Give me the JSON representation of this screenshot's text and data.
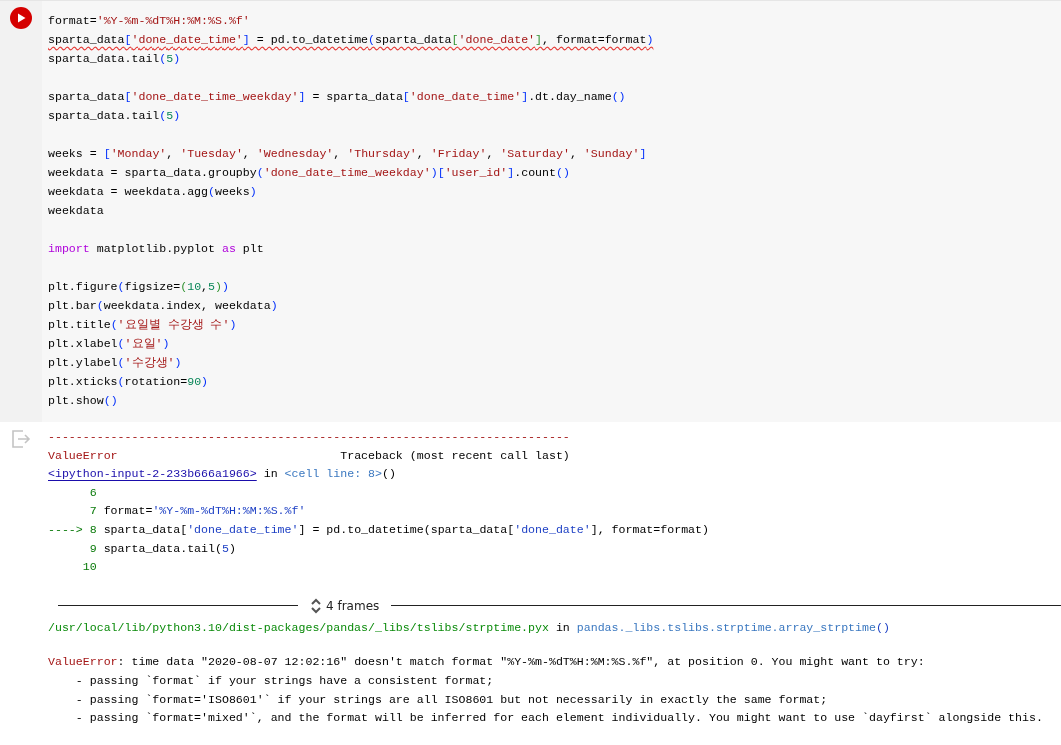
{
  "code_cell": {
    "run_button": {
      "kind": "play"
    },
    "blocks": [
      [
        {
          "lint_warning": false,
          "tokens": [
            {
              "text": "format=",
              "kind": "plain"
            },
            {
              "text": "'%Y-%m-%dT%H:%M:%S.%f'",
              "kind": "string"
            }
          ]
        },
        {
          "lint_warning": true,
          "tokens": [
            {
              "text": "sparta_data",
              "kind": "plain"
            },
            {
              "text": "[",
              "kind": "bracket"
            },
            {
              "text": "'done_date_time'",
              "kind": "string"
            },
            {
              "text": "]",
              "kind": "bracket"
            },
            {
              "text": " = pd.to_datetime",
              "kind": "plain"
            },
            {
              "text": "(",
              "kind": "bracket"
            },
            {
              "text": "sparta_data",
              "kind": "plain"
            },
            {
              "text": "[",
              "kind": "bracket2"
            },
            {
              "text": "'done_date'",
              "kind": "string"
            },
            {
              "text": "]",
              "kind": "bracket2"
            },
            {
              "text": ", format=format",
              "kind": "plain"
            },
            {
              "text": ")",
              "kind": "bracket"
            }
          ]
        },
        {
          "lint_warning": false,
          "tokens": [
            {
              "text": "sparta_data.tail",
              "kind": "plain"
            },
            {
              "text": "(",
              "kind": "bracket"
            },
            {
              "text": "5",
              "kind": "number"
            },
            {
              "text": ")",
              "kind": "bracket"
            }
          ]
        }
      ],
      [
        {
          "lint_warning": false,
          "tokens": [
            {
              "text": "sparta_data",
              "kind": "plain"
            },
            {
              "text": "[",
              "kind": "bracket"
            },
            {
              "text": "'done_date_time_weekday'",
              "kind": "string"
            },
            {
              "text": "]",
              "kind": "bracket"
            },
            {
              "text": " = sparta_data",
              "kind": "plain"
            },
            {
              "text": "[",
              "kind": "bracket"
            },
            {
              "text": "'done_date_time'",
              "kind": "string"
            },
            {
              "text": "]",
              "kind": "bracket"
            },
            {
              "text": ".dt.day_name",
              "kind": "plain"
            },
            {
              "text": "()",
              "kind": "bracket"
            }
          ]
        },
        {
          "lint_warning": false,
          "tokens": [
            {
              "text": "sparta_data.tail",
              "kind": "plain"
            },
            {
              "text": "(",
              "kind": "bracket"
            },
            {
              "text": "5",
              "kind": "number"
            },
            {
              "text": ")",
              "kind": "bracket"
            }
          ]
        }
      ],
      [
        {
          "lint_warning": false,
          "tokens": [
            {
              "text": "weeks = ",
              "kind": "plain"
            },
            {
              "text": "[",
              "kind": "bracket"
            },
            {
              "text": "'Monday'",
              "kind": "string"
            },
            {
              "text": ", ",
              "kind": "plain"
            },
            {
              "text": "'Tuesday'",
              "kind": "string"
            },
            {
              "text": ", ",
              "kind": "plain"
            },
            {
              "text": "'Wednesday'",
              "kind": "string"
            },
            {
              "text": ", ",
              "kind": "plain"
            },
            {
              "text": "'Thursday'",
              "kind": "string"
            },
            {
              "text": ", ",
              "kind": "plain"
            },
            {
              "text": "'Friday'",
              "kind": "string"
            },
            {
              "text": ", ",
              "kind": "plain"
            },
            {
              "text": "'Saturday'",
              "kind": "string"
            },
            {
              "text": ", ",
              "kind": "plain"
            },
            {
              "text": "'Sunday'",
              "kind": "string"
            },
            {
              "text": "]",
              "kind": "bracket"
            }
          ]
        },
        {
          "lint_warning": false,
          "tokens": [
            {
              "text": "weekdata = sparta_data.groupby",
              "kind": "plain"
            },
            {
              "text": "(",
              "kind": "bracket"
            },
            {
              "text": "'done_date_time_weekday'",
              "kind": "string"
            },
            {
              "text": ")",
              "kind": "bracket"
            },
            {
              "text": "[",
              "kind": "bracket"
            },
            {
              "text": "'user_id'",
              "kind": "string"
            },
            {
              "text": "]",
              "kind": "bracket"
            },
            {
              "text": ".count",
              "kind": "plain"
            },
            {
              "text": "()",
              "kind": "bracket"
            }
          ]
        },
        {
          "lint_warning": false,
          "tokens": [
            {
              "text": "weekdata = weekdata.agg",
              "kind": "plain"
            },
            {
              "text": "(",
              "kind": "bracket"
            },
            {
              "text": "weeks",
              "kind": "plain"
            },
            {
              "text": ")",
              "kind": "bracket"
            }
          ]
        },
        {
          "lint_warning": false,
          "tokens": [
            {
              "text": "weekdata",
              "kind": "plain"
            }
          ]
        }
      ],
      [
        {
          "lint_warning": false,
          "tokens": [
            {
              "text": "import",
              "kind": "keyword"
            },
            {
              "text": " matplotlib.pyplot ",
              "kind": "plain"
            },
            {
              "text": "as",
              "kind": "keyword"
            },
            {
              "text": " plt",
              "kind": "plain"
            }
          ]
        }
      ],
      [
        {
          "lint_warning": false,
          "tokens": [
            {
              "text": "plt.figure",
              "kind": "plain"
            },
            {
              "text": "(",
              "kind": "bracket"
            },
            {
              "text": "figsize=",
              "kind": "plain"
            },
            {
              "text": "(",
              "kind": "bracket2"
            },
            {
              "text": "10",
              "kind": "number"
            },
            {
              "text": ",",
              "kind": "plain"
            },
            {
              "text": "5",
              "kind": "number"
            },
            {
              "text": ")",
              "kind": "bracket2"
            },
            {
              "text": ")",
              "kind": "bracket"
            }
          ]
        },
        {
          "lint_warning": false,
          "tokens": [
            {
              "text": "plt.bar",
              "kind": "plain"
            },
            {
              "text": "(",
              "kind": "bracket"
            },
            {
              "text": "weekdata.index, weekdata",
              "kind": "plain"
            },
            {
              "text": ")",
              "kind": "bracket"
            }
          ]
        },
        {
          "lint_warning": false,
          "tokens": [
            {
              "text": "plt.title",
              "kind": "plain"
            },
            {
              "text": "(",
              "kind": "bracket"
            },
            {
              "text": "'요일별 수강생 수'",
              "kind": "string"
            },
            {
              "text": ")",
              "kind": "bracket"
            }
          ]
        },
        {
          "lint_warning": false,
          "tokens": [
            {
              "text": "plt.xlabel",
              "kind": "plain"
            },
            {
              "text": "(",
              "kind": "bracket"
            },
            {
              "text": "'요일'",
              "kind": "string"
            },
            {
              "text": ")",
              "kind": "bracket"
            }
          ]
        },
        {
          "lint_warning": false,
          "tokens": [
            {
              "text": "plt.ylabel",
              "kind": "plain"
            },
            {
              "text": "(",
              "kind": "bracket"
            },
            {
              "text": "'수강생'",
              "kind": "string"
            },
            {
              "text": ")",
              "kind": "bracket"
            }
          ]
        },
        {
          "lint_warning": false,
          "tokens": [
            {
              "text": "plt.xticks",
              "kind": "plain"
            },
            {
              "text": "(",
              "kind": "bracket"
            },
            {
              "text": "rotation=",
              "kind": "plain"
            },
            {
              "text": "90",
              "kind": "number"
            },
            {
              "text": ")",
              "kind": "bracket"
            }
          ]
        },
        {
          "lint_warning": false,
          "tokens": [
            {
              "text": "plt.show",
              "kind": "plain"
            },
            {
              "text": "()",
              "kind": "bracket"
            }
          ]
        }
      ]
    ]
  },
  "output": {
    "traceback": [
      {
        "tokens": [
          {
            "text": "---------------------------------------------------------------------------",
            "kind": "error"
          }
        ]
      },
      {
        "tokens": [
          {
            "text": "ValueError",
            "kind": "error"
          },
          {
            "text": "                                Traceback (most recent call last)",
            "kind": "plain"
          }
        ]
      },
      {
        "tokens": [
          {
            "text": "<ipython-input-2-233b666a1966>",
            "kind": "link"
          },
          {
            "text": " in ",
            "kind": "plain"
          },
          {
            "text": "<cell line: 8>",
            "kind": "ref"
          },
          {
            "text": "()",
            "kind": "plain"
          }
        ]
      },
      {
        "tokens": [
          {
            "text": "      6",
            "kind": "linenum"
          }
        ]
      },
      {
        "tokens": [
          {
            "text": "      7",
            "kind": "linenum"
          },
          {
            "text": " format=",
            "kind": "plain"
          },
          {
            "text": "'%Y-%m-%dT%H:%M:%S.%f'",
            "kind": "ostring"
          }
        ]
      },
      {
        "tokens": [
          {
            "text": "----> 8",
            "kind": "linenum"
          },
          {
            "text": " sparta_data[",
            "kind": "plain"
          },
          {
            "text": "'done_date_time'",
            "kind": "ostring"
          },
          {
            "text": "] = pd.to_datetime(sparta_data[",
            "kind": "plain"
          },
          {
            "text": "'done_date'",
            "kind": "ostring"
          },
          {
            "text": "], format=format)",
            "kind": "plain"
          }
        ]
      },
      {
        "tokens": [
          {
            "text": "      9",
            "kind": "linenum"
          },
          {
            "text": " sparta_data.tail(",
            "kind": "plain"
          },
          {
            "text": "5",
            "kind": "ostring"
          },
          {
            "text": ")",
            "kind": "plain"
          }
        ]
      },
      {
        "tokens": [
          {
            "text": "     10",
            "kind": "linenum"
          }
        ]
      }
    ],
    "frames_toggle": {
      "label": "4 frames",
      "expanded": false
    },
    "location": [
      {
        "tokens": [
          {
            "text": "/usr/local/lib/python3.10/dist-packages/pandas/_libs/tslibs/strptime.pyx",
            "kind": "path"
          },
          {
            "text": " in ",
            "kind": "plain"
          },
          {
            "text": "pandas._libs.tslibs.strptime.array_strptime",
            "kind": "ref"
          },
          {
            "text": "()",
            "kind": "ostring"
          }
        ]
      }
    ],
    "message": [
      {
        "tokens": [
          {
            "text": "ValueError",
            "kind": "error"
          },
          {
            "text": ": time data \"2020-08-07 12:02:16\" doesn't match format \"%Y-%m-%dT%H:%M:%S.%f\", at position 0. You might want to try:",
            "kind": "plain"
          }
        ]
      },
      {
        "tokens": [
          {
            "text": "    - passing `format` if your strings have a consistent format;",
            "kind": "plain"
          }
        ]
      },
      {
        "tokens": [
          {
            "text": "    - passing `format='ISO8601'` if your strings are all ISO8601 but not necessarily in exactly the same format;",
            "kind": "plain"
          }
        ]
      },
      {
        "tokens": [
          {
            "text": "    - passing `format='mixed'`, and the format will be inferred for each element individually. You might want to use `dayfirst` alongside this.",
            "kind": "plain"
          }
        ]
      }
    ]
  }
}
